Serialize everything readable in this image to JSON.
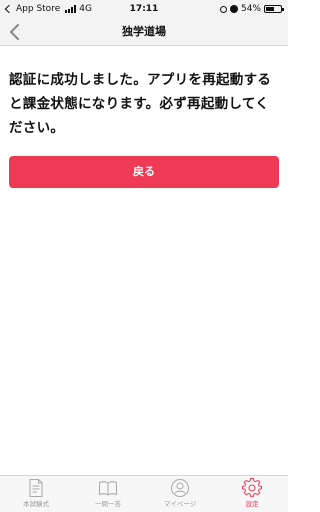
{
  "status": {
    "back_app": "App Store",
    "network": "4G",
    "time": "17:11",
    "battery": "54%",
    "battery_level": 0.54
  },
  "nav": {
    "title": "独学道場"
  },
  "main": {
    "message": "認証に成功しました。アプリを再起動すると課金状態になります。必ず再起動してください。",
    "button_label": "戻る"
  },
  "tabs": [
    {
      "label": "本試験式",
      "icon": "exam-sheet-icon"
    },
    {
      "label": "一問一答",
      "icon": "open-book-icon"
    },
    {
      "label": "マイページ",
      "icon": "user-icon"
    },
    {
      "label": "設定",
      "icon": "gear-icon",
      "active": true
    }
  ],
  "colors": {
    "accent": "#ee3a55",
    "tab_inactive": "#999999"
  }
}
